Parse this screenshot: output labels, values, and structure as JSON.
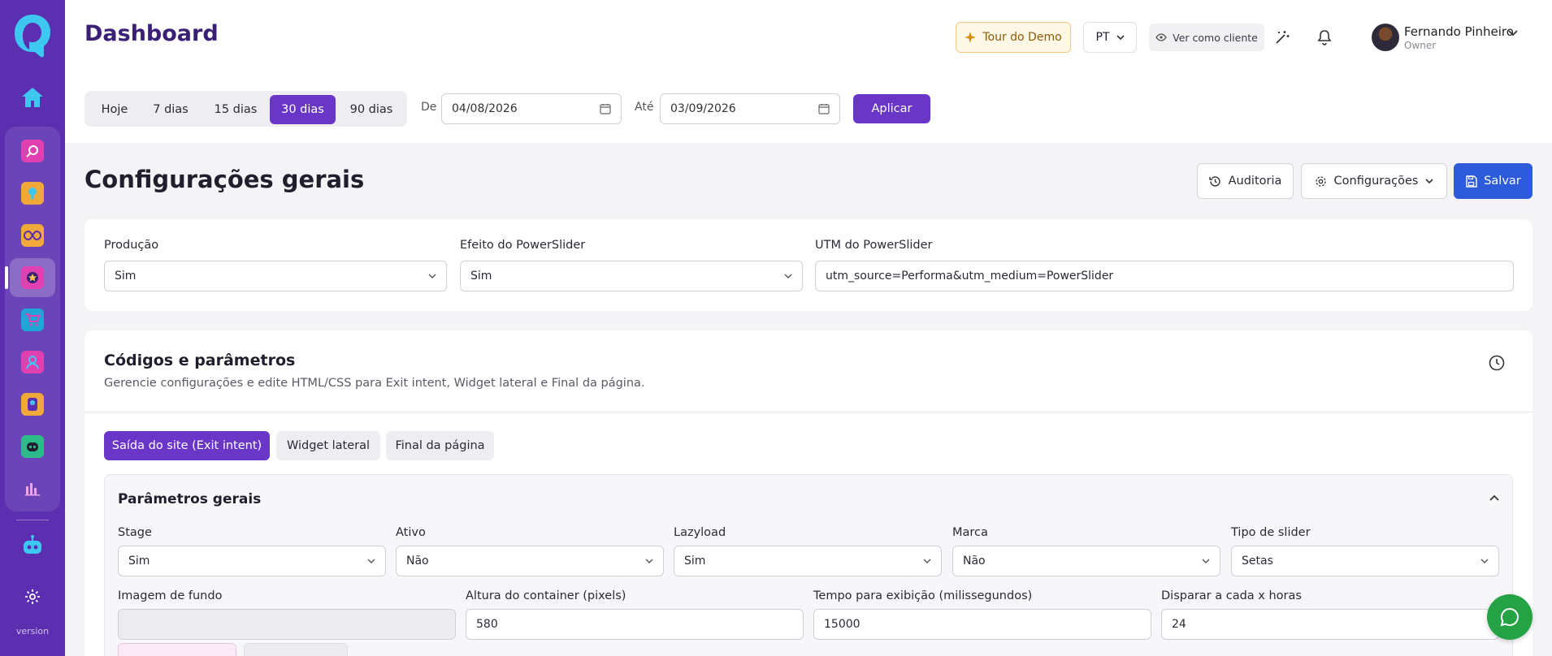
{
  "header": {
    "title": "Dashboard",
    "tour_label": "Tour do Demo",
    "language": "PT",
    "view_as_client": "Ver como cliente",
    "user_name": "Fernando Pinheiro",
    "user_role": "Owner"
  },
  "sidebar": {
    "version_label": "version",
    "apps": [
      {
        "icon": "search-app-icon",
        "color": "#e040b0"
      },
      {
        "icon": "bulb-app-icon",
        "color": "#f2a93b"
      },
      {
        "icon": "infinity-app-icon",
        "color": "#f2a93b"
      },
      {
        "icon": "star-app-icon",
        "color": "#e040b0",
        "active": true
      },
      {
        "icon": "cart-app-icon",
        "color": "#1ea7d6"
      },
      {
        "icon": "user-app-icon",
        "color": "#e040b0"
      },
      {
        "icon": "badge-app-icon",
        "color": "#f2a93b"
      },
      {
        "icon": "robot-app-icon",
        "color": "#2dbb8a"
      },
      {
        "icon": "chart-app-icon",
        "color": "#7a52d6"
      }
    ]
  },
  "filters": {
    "ranges": [
      "Hoje",
      "7 dias",
      "15 dias",
      "30 dias",
      "90 dias"
    ],
    "active_range": "30 dias",
    "from_label": "De",
    "from_value": "04/08/2026",
    "to_label": "Até",
    "to_value": "03/09/2026",
    "apply_label": "Aplicar"
  },
  "page": {
    "title": "Configurações gerais",
    "audit_label": "Auditoria",
    "settings_label": "Configurações",
    "save_label": "Salvar"
  },
  "general": {
    "producao_label": "Produção",
    "producao_value": "Sim",
    "efeito_label": "Efeito do PowerSlider",
    "efeito_value": "Sim",
    "utm_label": "UTM do PowerSlider",
    "utm_value": "utm_source=Performa&utm_medium=PowerSlider"
  },
  "codes": {
    "title": "Códigos e parâmetros",
    "subtitle": "Gerencie configurações e edite HTML/CSS para Exit intent, Widget lateral e Final da página.",
    "tabs": [
      "Saída do site (Exit intent)",
      "Widget lateral",
      "Final da página"
    ],
    "active_tab": 0,
    "panel_title": "Parâmetros gerais",
    "row1": [
      {
        "label": "Stage",
        "value": "Sim"
      },
      {
        "label": "Ativo",
        "value": "Não"
      },
      {
        "label": "Lazyload",
        "value": "Sim"
      },
      {
        "label": "Marca",
        "value": "Não"
      },
      {
        "label": "Tipo de slider",
        "value": "Setas"
      }
    ],
    "row2": [
      {
        "label": "Imagem de fundo",
        "value": ""
      },
      {
        "label": "Altura do container (pixels)",
        "value": "580"
      },
      {
        "label": "Tempo para exibição (milissegundos)",
        "value": "15000"
      },
      {
        "label": "Disparar a cada x horas",
        "value": "24"
      }
    ]
  },
  "colors": {
    "sidebar": "#5b2fb0",
    "accent": "#6a36c8",
    "save": "#2e5bd9",
    "chat": "#25a244"
  }
}
